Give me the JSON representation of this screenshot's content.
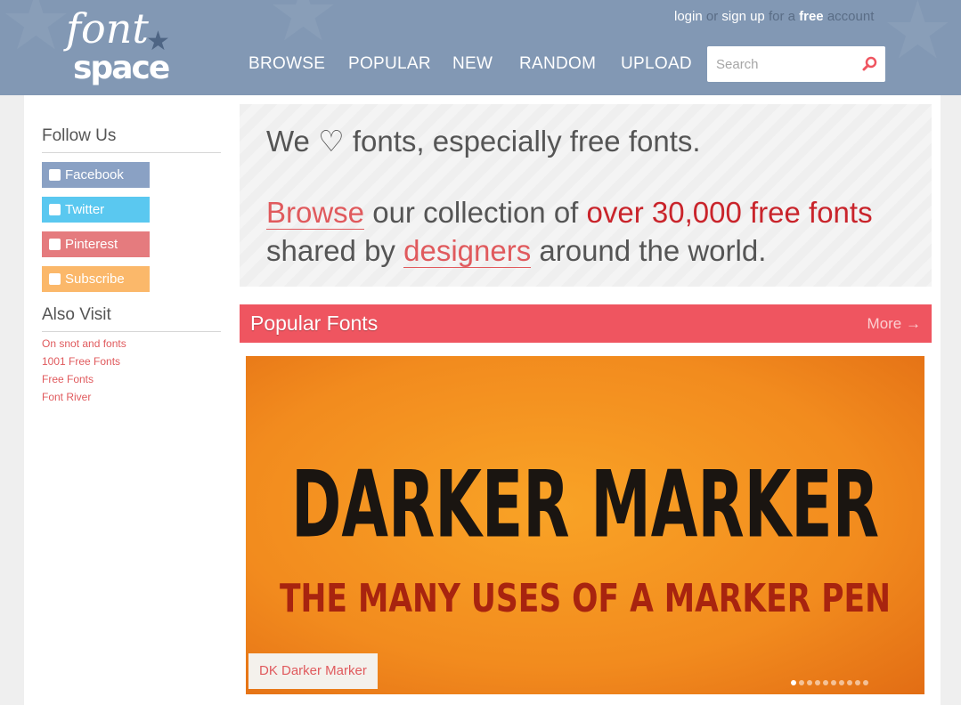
{
  "header": {
    "logo_top": "font",
    "logo_bottom": "space",
    "login": "login",
    "or": "or",
    "signup": "sign up",
    "for_a": "for a",
    "free": "free",
    "account": "account",
    "nav": [
      {
        "label": "BROWSE"
      },
      {
        "label": "POPULAR"
      },
      {
        "label": "NEW"
      },
      {
        "label": "RANDOM"
      },
      {
        "label": "UPLOAD"
      }
    ],
    "search_placeholder": "Search"
  },
  "sidebar": {
    "follow_title": "Follow Us",
    "social": [
      {
        "label": "Facebook",
        "color": "#8aa1c4"
      },
      {
        "label": "Twitter",
        "color": "#5ac8f0"
      },
      {
        "label": "Pinterest",
        "color": "#e57b7e"
      },
      {
        "label": "Subscribe",
        "color": "#fbb86a"
      }
    ],
    "also_title": "Also Visit",
    "links": [
      "On snot and fonts",
      "1001 Free Fonts",
      "Free Fonts",
      "Font River"
    ]
  },
  "hero": {
    "we": "We",
    "heart": "♡",
    "rest1": "fonts, especially free fonts.",
    "browse": "Browse",
    "our_collection": "our collection of",
    "count": "over 30,000 free fonts",
    "shared_by": "shared by",
    "designers": "designers",
    "around": "around the world."
  },
  "popular": {
    "title": "Popular Fonts",
    "more": "More →"
  },
  "banner": {
    "line1": "DARKER MARKER",
    "line2": "THE MANY USES OF A MARKER PEN",
    "tag": "DK Darker Marker",
    "slides": 10,
    "active_slide": 1
  },
  "colors": {
    "header_bg": "#8298b4",
    "accent": "#ef5560",
    "link": "#e05a5d",
    "highlight": "#c9242b"
  }
}
